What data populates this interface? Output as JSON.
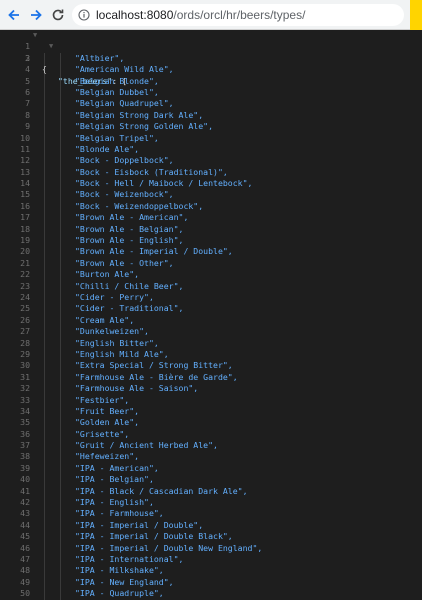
{
  "browser": {
    "url_host": "localhost:8080",
    "url_path": "/ords/orcl/hr/beers/types/",
    "accent_color": "#ffd400"
  },
  "json_viewer": {
    "open_brace": "{",
    "key": "\"the_beers\"",
    "key_suffix": ": [",
    "lines": [
      {
        "n": "3",
        "v": "\"Altbier\","
      },
      {
        "n": "4",
        "v": "\"American Wild Ale\","
      },
      {
        "n": "5",
        "v": "\"Belgian Blonde\","
      },
      {
        "n": "6",
        "v": "\"Belgian Dubbel\","
      },
      {
        "n": "7",
        "v": "\"Belgian Quadrupel\","
      },
      {
        "n": "8",
        "v": "\"Belgian Strong Dark Ale\","
      },
      {
        "n": "9",
        "v": "\"Belgian Strong Golden Ale\","
      },
      {
        "n": "10",
        "v": "\"Belgian Tripel\","
      },
      {
        "n": "11",
        "v": "\"Blonde Ale\","
      },
      {
        "n": "12",
        "v": "\"Bock - Doppelbock\","
      },
      {
        "n": "13",
        "v": "\"Bock - Eisbock (Traditional)\","
      },
      {
        "n": "14",
        "v": "\"Bock - Hell / Maibock / Lentebock\","
      },
      {
        "n": "15",
        "v": "\"Bock - Weizenbock\","
      },
      {
        "n": "16",
        "v": "\"Bock - Weizendoppelbock\","
      },
      {
        "n": "17",
        "v": "\"Brown Ale - American\","
      },
      {
        "n": "18",
        "v": "\"Brown Ale - Belgian\","
      },
      {
        "n": "19",
        "v": "\"Brown Ale - English\","
      },
      {
        "n": "20",
        "v": "\"Brown Ale - Imperial / Double\","
      },
      {
        "n": "21",
        "v": "\"Brown Ale - Other\","
      },
      {
        "n": "22",
        "v": "\"Burton Ale\","
      },
      {
        "n": "23",
        "v": "\"Chilli / Chile Beer\","
      },
      {
        "n": "24",
        "v": "\"Cider - Perry\","
      },
      {
        "n": "25",
        "v": "\"Cider - Traditional\","
      },
      {
        "n": "26",
        "v": "\"Cream Ale\","
      },
      {
        "n": "27",
        "v": "\"Dunkelweizen\","
      },
      {
        "n": "28",
        "v": "\"English Bitter\","
      },
      {
        "n": "29",
        "v": "\"English Mild Ale\","
      },
      {
        "n": "30",
        "v": "\"Extra Special / Strong Bitter\","
      },
      {
        "n": "31",
        "v": "\"Farmhouse Ale - Bière de Garde\","
      },
      {
        "n": "32",
        "v": "\"Farmhouse Ale - Saison\","
      },
      {
        "n": "33",
        "v": "\"Festbier\","
      },
      {
        "n": "34",
        "v": "\"Fruit Beer\","
      },
      {
        "n": "35",
        "v": "\"Golden Ale\","
      },
      {
        "n": "36",
        "v": "\"Grisette\","
      },
      {
        "n": "37",
        "v": "\"Gruit / Ancient Herbed Ale\","
      },
      {
        "n": "38",
        "v": "\"Hefeweizen\","
      },
      {
        "n": "39",
        "v": "\"IPA - American\","
      },
      {
        "n": "40",
        "v": "\"IPA - Belgian\","
      },
      {
        "n": "41",
        "v": "\"IPA - Black / Cascadian Dark Ale\","
      },
      {
        "n": "42",
        "v": "\"IPA - English\","
      },
      {
        "n": "43",
        "v": "\"IPA - Farmhouse\","
      },
      {
        "n": "44",
        "v": "\"IPA - Imperial / Double\","
      },
      {
        "n": "45",
        "v": "\"IPA - Imperial / Double Black\","
      },
      {
        "n": "46",
        "v": "\"IPA - Imperial / Double New England\","
      },
      {
        "n": "47",
        "v": "\"IPA - International\","
      },
      {
        "n": "48",
        "v": "\"IPA - Milkshake\","
      },
      {
        "n": "49",
        "v": "\"IPA - New England\","
      },
      {
        "n": "50",
        "v": "\"IPA - Quadruple\","
      }
    ]
  }
}
